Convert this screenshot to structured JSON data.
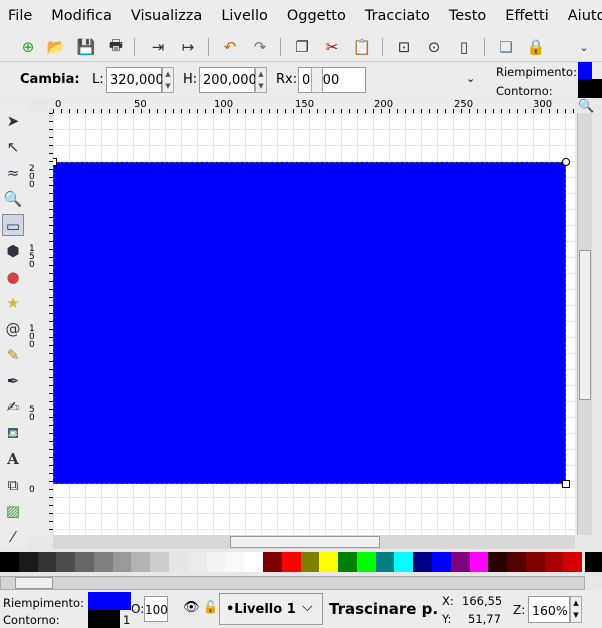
{
  "menu": [
    "File",
    "Modifica",
    "Visualizza",
    "Livello",
    "Oggetto",
    "Tracciato",
    "Testo",
    "Effetti",
    "Aiuto"
  ],
  "toolbar_icons": [
    "new-document",
    "open",
    "save",
    "print",
    "import",
    "export",
    "undo",
    "redo",
    "duplicate",
    "cut",
    "paste",
    "zoom-selection",
    "zoom-drawing",
    "zoom-page",
    "group",
    "lock",
    "more"
  ],
  "controls": {
    "label": "Cambia:",
    "w_label": "L:",
    "w_value": "320,000",
    "h_label": "H:",
    "h_value": "200,000",
    "rx_label": "Rx:",
    "rx_value": "0,000"
  },
  "style_indicator": {
    "fill_label": "Riempimento:",
    "stroke_label": "Contorno:",
    "fill_color": "#0000ff",
    "stroke_color": "#000000"
  },
  "ruler_top": [
    "0",
    "50",
    "100",
    "150",
    "200",
    "250",
    "300"
  ],
  "ruler_left": [
    "200",
    "150",
    "100",
    "50",
    "0"
  ],
  "tools": [
    "selector",
    "node",
    "tweak",
    "zoom",
    "rectangle",
    "3d-box",
    "ellipse",
    "star",
    "spiral",
    "pencil",
    "pen",
    "calligraphy",
    "paint-bucket",
    "text",
    "connector",
    "gradient",
    "dropper"
  ],
  "palette": [
    "#000000",
    "#1a1a1a",
    "#333333",
    "#4d4d4d",
    "#666666",
    "#808080",
    "#999999",
    "#b3b3b3",
    "#cccccc",
    "#e6e6e6",
    "#ececec",
    "#f2f2f2",
    "#f9f9f9",
    "#ffffff",
    "#800000",
    "#ff0000",
    "#808000",
    "#ffff00",
    "#008000",
    "#00ff00",
    "#008080",
    "#00ffff",
    "#000080",
    "#0000ff",
    "#800080",
    "#ff00ff",
    "#2b0000",
    "#550000",
    "#800000",
    "#aa0000",
    "#d40000"
  ],
  "status": {
    "fill_label": "Riempimento:",
    "stroke_label": "Contorno:",
    "stroke_width": "1",
    "opacity_label": "O:",
    "opacity_value": "100",
    "layer": "•Livello 1",
    "message": "Trascinare p.",
    "x_label": "X:",
    "x_value": "166,55",
    "y_label": "Y:",
    "y_value": "51,77",
    "zoom_label": "Z:",
    "zoom_value": "160%"
  }
}
